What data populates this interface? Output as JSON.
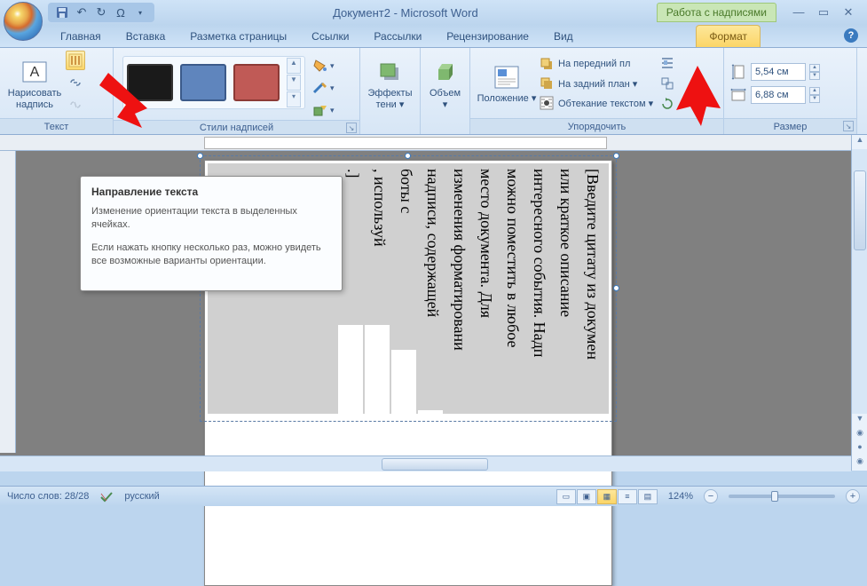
{
  "window": {
    "title": "Документ2 - Microsoft Word",
    "context_tab": "Работа с надписями"
  },
  "qat": {
    "save": "save-icon",
    "undo": "undo-icon",
    "redo": "redo-icon",
    "omega": "Ω"
  },
  "tabs": [
    "Главная",
    "Вставка",
    "Разметка страницы",
    "Ссылки",
    "Рассылки",
    "Рецензирование",
    "Вид",
    "Формат"
  ],
  "active_tab": "Формат",
  "ribbon": {
    "text_group": {
      "label": "Текст",
      "draw": "Нарисовать\nнадпись"
    },
    "styles_group": {
      "label": "Стили надписей",
      "swatches": [
        "#1a1a1a",
        "#5f85bd",
        "#c05a56"
      ]
    },
    "effects": {
      "label": "Эффекты\nтени ▾"
    },
    "volume": {
      "label": "Объем ▾"
    },
    "arrange": {
      "label": "Упорядочить",
      "position": "Положение ▾",
      "front": "На передний пл",
      "back": "На задний план ▾",
      "wrap": "Обтекание текстом ▾"
    },
    "size": {
      "label": "Размер",
      "height": "5,54 см",
      "width": "6,88 см"
    }
  },
  "tooltip": {
    "title": "Направление текста",
    "p1": "Изменение ориентации текста в выделенных ячейках.",
    "p2": "Если нажать кнопку несколько раз, можно увидеть все возможные варианты ориентации."
  },
  "document": {
    "columns": [
      {
        "text": "[Введите цитату из докумен",
        "mask": 0
      },
      {
        "text": "или краткое описание",
        "mask": 0
      },
      {
        "text": "интересного события. Надп",
        "mask": 0
      },
      {
        "text": "можно поместить в любое",
        "mask": 0
      },
      {
        "text": "место документа. Для",
        "mask": 0
      },
      {
        "text": "изменения форматировани",
        "mask": 0
      },
      {
        "text": "надписи, содержащей",
        "mask": 44
      },
      {
        "text": "        боты с",
        "mask": 112
      },
      {
        "text": "                  , используй",
        "mask": 140
      },
      {
        "text": "                           .]",
        "mask": 140
      }
    ]
  },
  "status": {
    "words": "Число слов: 28/28",
    "lang": "русский",
    "zoom": "124%"
  }
}
